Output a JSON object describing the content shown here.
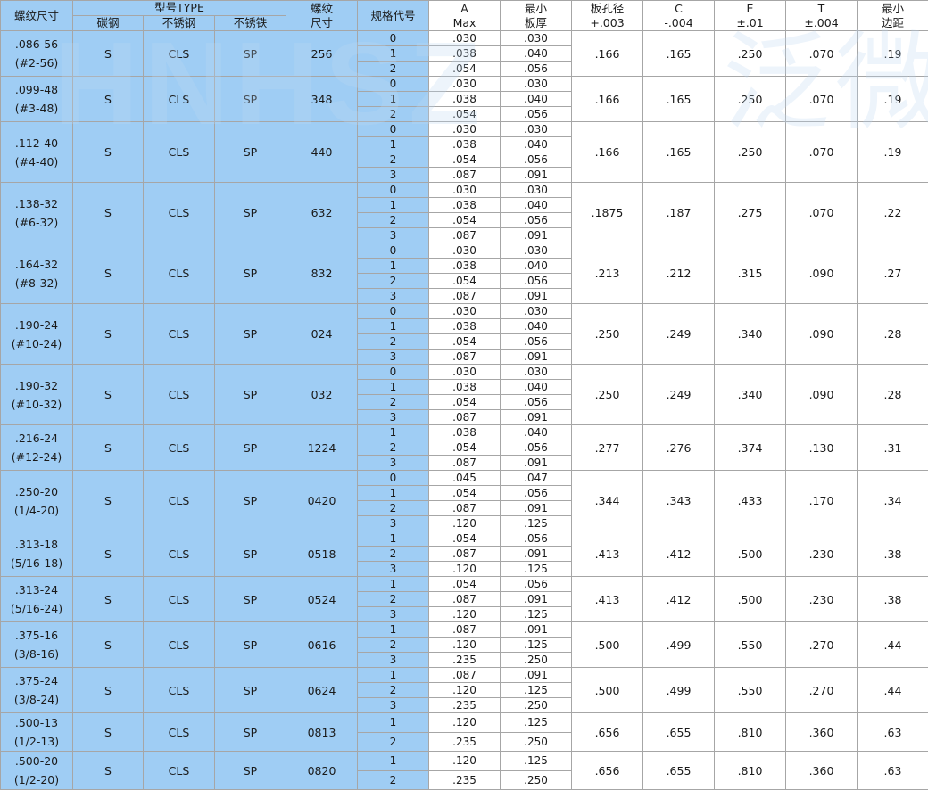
{
  "headers": {
    "thread_size": "螺纹尺寸",
    "type_group": "型号TYPE",
    "type_carbon": "碳钢",
    "type_stainless": "不锈钢",
    "type_stainless_iron": "不锈铁",
    "thread_code_l1": "螺纹",
    "thread_code_l2": "尺寸",
    "spec_code": "规格代号",
    "a_l1": "A",
    "a_l2": "Max",
    "min_l1": "最小",
    "min_l2": "板厚",
    "hole_l1": "板孔径",
    "hole_l2": "+.003",
    "c_l1": "C",
    "c_l2": "-.004",
    "e_l1": "E",
    "e_l2": "±.01",
    "t_l1": "T",
    "t_l2": "±.004",
    "edge_l1": "最小",
    "edge_l2": "边距"
  },
  "watermark": {
    "latin": "HNHSZ",
    "cjk": "泛微"
  },
  "colors": {
    "blue_fill": "#9fcdf4",
    "grid": "#a6a6a6",
    "white": "#ffffff"
  },
  "rows": [
    {
      "size": ".086-56",
      "alt": "(#2-56)",
      "carbon": "S",
      "stainless": "CLS",
      "iron": "SP",
      "code": "256",
      "hole": ".166",
      "c": ".165",
      "e": ".250",
      "t": ".070",
      "edge": ".19",
      "subs": [
        {
          "n": "0",
          "a": ".030",
          "m": ".030"
        },
        {
          "n": "1",
          "a": ".038",
          "m": ".040"
        },
        {
          "n": "2",
          "a": ".054",
          "m": ".056"
        }
      ]
    },
    {
      "size": ".099-48",
      "alt": "(#3-48)",
      "carbon": "S",
      "stainless": "CLS",
      "iron": "SP",
      "code": "348",
      "hole": ".166",
      "c": ".165",
      "e": ".250",
      "t": ".070",
      "edge": ".19",
      "subs": [
        {
          "n": "0",
          "a": ".030",
          "m": ".030"
        },
        {
          "n": "1",
          "a": ".038",
          "m": ".040"
        },
        {
          "n": "2",
          "a": ".054",
          "m": ".056"
        }
      ]
    },
    {
      "size": ".112-40",
      "alt": "(#4-40)",
      "carbon": "S",
      "stainless": "CLS",
      "iron": "SP",
      "code": "440",
      "hole": ".166",
      "c": ".165",
      "e": ".250",
      "t": ".070",
      "edge": ".19",
      "subs": [
        {
          "n": "0",
          "a": ".030",
          "m": ".030"
        },
        {
          "n": "1",
          "a": ".038",
          "m": ".040"
        },
        {
          "n": "2",
          "a": ".054",
          "m": ".056"
        },
        {
          "n": "3",
          "a": ".087",
          "m": ".091"
        }
      ]
    },
    {
      "size": ".138-32",
      "alt": "(#6-32)",
      "carbon": "S",
      "stainless": "CLS",
      "iron": "SP",
      "code": "632",
      "hole": ".1875",
      "c": ".187",
      "e": ".275",
      "t": ".070",
      "edge": ".22",
      "subs": [
        {
          "n": "0",
          "a": ".030",
          "m": ".030"
        },
        {
          "n": "1",
          "a": ".038",
          "m": ".040"
        },
        {
          "n": "2",
          "a": ".054",
          "m": ".056"
        },
        {
          "n": "3",
          "a": ".087",
          "m": ".091"
        }
      ]
    },
    {
      "size": ".164-32",
      "alt": "(#8-32)",
      "carbon": "S",
      "stainless": "CLS",
      "iron": "SP",
      "code": "832",
      "hole": ".213",
      "c": ".212",
      "e": ".315",
      "t": ".090",
      "edge": ".27",
      "subs": [
        {
          "n": "0",
          "a": ".030",
          "m": ".030"
        },
        {
          "n": "1",
          "a": ".038",
          "m": ".040"
        },
        {
          "n": "2",
          "a": ".054",
          "m": ".056"
        },
        {
          "n": "3",
          "a": ".087",
          "m": ".091"
        }
      ]
    },
    {
      "size": ".190-24",
      "alt": "(#10-24)",
      "carbon": "S",
      "stainless": "CLS",
      "iron": "SP",
      "code": "024",
      "hole": ".250",
      "c": ".249",
      "e": ".340",
      "t": ".090",
      "edge": ".28",
      "subs": [
        {
          "n": "0",
          "a": ".030",
          "m": ".030"
        },
        {
          "n": "1",
          "a": ".038",
          "m": ".040"
        },
        {
          "n": "2",
          "a": ".054",
          "m": ".056"
        },
        {
          "n": "3",
          "a": ".087",
          "m": ".091"
        }
      ]
    },
    {
      "size": ".190-32",
      "alt": "(#10-32)",
      "carbon": "S",
      "stainless": "CLS",
      "iron": "SP",
      "code": "032",
      "hole": ".250",
      "c": ".249",
      "e": ".340",
      "t": ".090",
      "edge": ".28",
      "subs": [
        {
          "n": "0",
          "a": ".030",
          "m": ".030"
        },
        {
          "n": "1",
          "a": ".038",
          "m": ".040"
        },
        {
          "n": "2",
          "a": ".054",
          "m": ".056"
        },
        {
          "n": "3",
          "a": ".087",
          "m": ".091"
        }
      ]
    },
    {
      "size": ".216-24",
      "alt": "(#12-24)",
      "carbon": "S",
      "stainless": "CLS",
      "iron": "SP",
      "code": "1224",
      "hole": ".277",
      "c": ".276",
      "e": ".374",
      "t": ".130",
      "edge": ".31",
      "subs": [
        {
          "n": "1",
          "a": ".038",
          "m": ".040"
        },
        {
          "n": "2",
          "a": ".054",
          "m": ".056"
        },
        {
          "n": "3",
          "a": ".087",
          "m": ".091"
        }
      ]
    },
    {
      "size": ".250-20",
      "alt": "(1/4-20)",
      "carbon": "S",
      "stainless": "CLS",
      "iron": "SP",
      "code": "0420",
      "hole": ".344",
      "c": ".343",
      "e": ".433",
      "t": ".170",
      "edge": ".34",
      "subs": [
        {
          "n": "0",
          "a": ".045",
          "m": ".047"
        },
        {
          "n": "1",
          "a": ".054",
          "m": ".056"
        },
        {
          "n": "2",
          "a": ".087",
          "m": ".091"
        },
        {
          "n": "3",
          "a": ".120",
          "m": ".125"
        }
      ]
    },
    {
      "size": ".313-18",
      "alt": "(5/16-18)",
      "carbon": "S",
      "stainless": "CLS",
      "iron": "SP",
      "code": "0518",
      "hole": ".413",
      "c": ".412",
      "e": ".500",
      "t": ".230",
      "edge": ".38",
      "subs": [
        {
          "n": "1",
          "a": ".054",
          "m": ".056"
        },
        {
          "n": "2",
          "a": ".087",
          "m": ".091"
        },
        {
          "n": "3",
          "a": ".120",
          "m": ".125"
        }
      ]
    },
    {
      "size": ".313-24",
      "alt": "(5/16-24)",
      "carbon": "S",
      "stainless": "CLS",
      "iron": "SP",
      "code": "0524",
      "hole": ".413",
      "c": ".412",
      "e": ".500",
      "t": ".230",
      "edge": ".38",
      "subs": [
        {
          "n": "1",
          "a": ".054",
          "m": ".056"
        },
        {
          "n": "2",
          "a": ".087",
          "m": ".091"
        },
        {
          "n": "3",
          "a": ".120",
          "m": ".125"
        }
      ]
    },
    {
      "size": ".375-16",
      "alt": "(3/8-16)",
      "carbon": "S",
      "stainless": "CLS",
      "iron": "SP",
      "code": "0616",
      "hole": ".500",
      "c": ".499",
      "e": ".550",
      "t": ".270",
      "edge": ".44",
      "subs": [
        {
          "n": "1",
          "a": ".087",
          "m": ".091"
        },
        {
          "n": "2",
          "a": ".120",
          "m": ".125"
        },
        {
          "n": "3",
          "a": ".235",
          "m": ".250"
        }
      ]
    },
    {
      "size": ".375-24",
      "alt": "(3/8-24)",
      "carbon": "S",
      "stainless": "CLS",
      "iron": "SP",
      "code": "0624",
      "hole": ".500",
      "c": ".499",
      "e": ".550",
      "t": ".270",
      "edge": ".44",
      "subs": [
        {
          "n": "1",
          "a": ".087",
          "m": ".091"
        },
        {
          "n": "2",
          "a": ".120",
          "m": ".125"
        },
        {
          "n": "3",
          "a": ".235",
          "m": ".250"
        }
      ]
    },
    {
      "size": ".500-13",
      "alt": "(1/2-13)",
      "carbon": "S",
      "stainless": "CLS",
      "iron": "SP",
      "code": "0813",
      "hole": ".656",
      "c": ".655",
      "e": ".810",
      "t": ".360",
      "edge": ".63",
      "subs": [
        {
          "n": "1",
          "a": ".120",
          "m": ".125"
        },
        {
          "n": "2",
          "a": ".235",
          "m": ".250"
        }
      ]
    },
    {
      "size": ".500-20",
      "alt": "(1/2-20)",
      "carbon": "S",
      "stainless": "CLS",
      "iron": "SP",
      "code": "0820",
      "hole": ".656",
      "c": ".655",
      "e": ".810",
      "t": ".360",
      "edge": ".63",
      "subs": [
        {
          "n": "1",
          "a": ".120",
          "m": ".125"
        },
        {
          "n": "2",
          "a": ".235",
          "m": ".250"
        }
      ]
    }
  ]
}
